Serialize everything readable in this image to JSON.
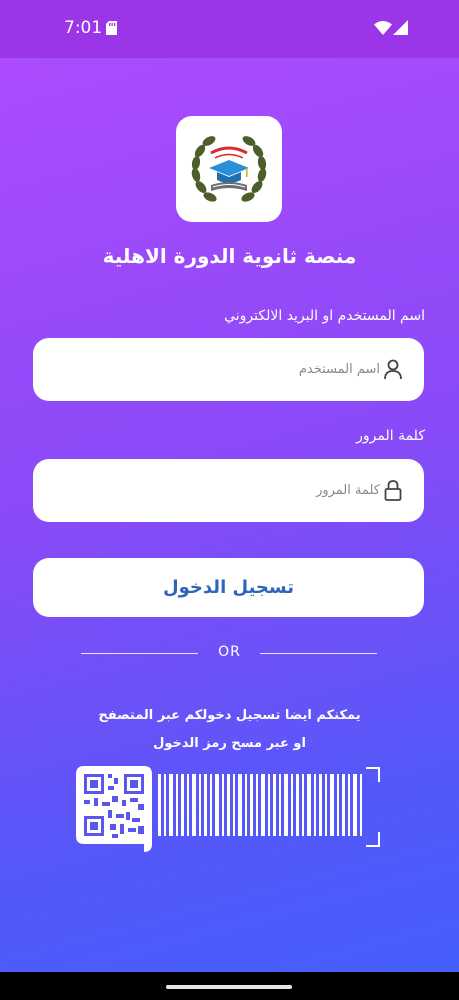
{
  "status_bar": {
    "time": "7:01",
    "icons": [
      "sd-card-icon",
      "wifi-icon",
      "cellular-signal-icon"
    ]
  },
  "app": {
    "title": "منصة ثانوية الدورة الاهلية",
    "logo_icon": "school-graduation-cap-laurel-logo"
  },
  "form": {
    "username": {
      "label": "اسم المستخدم او البريد الالكتروني",
      "placeholder": "اسم المستخدم",
      "value": "",
      "icon": "user-icon"
    },
    "password": {
      "label": "كلمة المرور",
      "placeholder": "كلمة المرور",
      "value": "",
      "icon": "lock-icon"
    },
    "submit_label": "تسجيل الدخول"
  },
  "divider": {
    "text": "OR"
  },
  "alternative": {
    "line1": "يمكنكم ايضا تسجيل دخولكم عبر المتصفح",
    "line2": "او عبر مسح رمز الدخول",
    "scan_icon": "qr-barcode-scan-icon"
  },
  "colors": {
    "status_bar": "#9a35e8",
    "gradient_top": "#ac4bff",
    "gradient_bottom": "#455ffc",
    "button_text": "#2f66b8"
  }
}
